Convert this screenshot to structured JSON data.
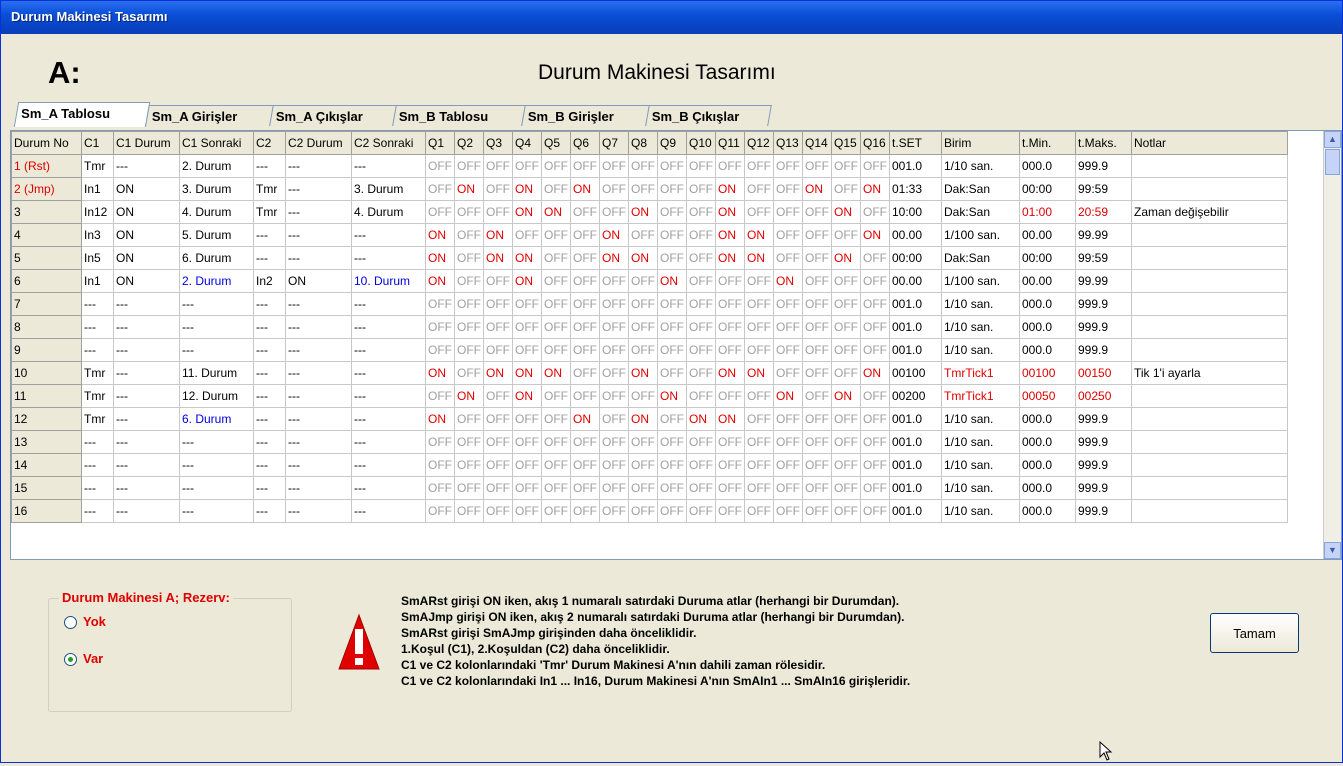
{
  "window": {
    "title": "Durum Makinesi Tasarımı"
  },
  "header": {
    "letter": "A:",
    "title": "Durum Makinesi Tasarımı"
  },
  "tabs": [
    "Sm_A Tablosu",
    "Sm_A Girişler",
    "Sm_A Çıkışlar",
    "Sm_B Tablosu",
    "Sm_B Girişler",
    "Sm_B Çıkışlar"
  ],
  "table": {
    "columns": [
      "Durum No",
      "C1",
      "C1 Durum",
      "C1 Sonraki",
      "C2",
      "C2 Durum",
      "C2 Sonraki",
      "Q1",
      "Q2",
      "Q3",
      "Q4",
      "Q5",
      "Q6",
      "Q7",
      "Q8",
      "Q9",
      "Q10",
      "Q11",
      "Q12",
      "Q13",
      "Q14",
      "Q15",
      "Q16",
      "t.SET",
      "Birim",
      "t.Min.",
      "t.Maks.",
      "Notlar"
    ],
    "rows": [
      {
        "no": "1 (Rst)",
        "c1": "Tmr",
        "c1d": "---",
        "c1s": "2. Durum",
        "c2": "---",
        "c2d": "---",
        "c2s": "---",
        "q": "0000000000000000",
        "tset": "001.0",
        "birim": "1/10 san.",
        "tmin": "000.0",
        "tmax": "999.9",
        "not": ""
      },
      {
        "no": "2 (Jmp)",
        "c1": "In1",
        "c1d": "ON",
        "c1s": "3. Durum",
        "c2": "Tmr",
        "c2d": "---",
        "c2s": "3. Durum",
        "q": "0101010000100101",
        "tset": "01:33",
        "birim": "Dak:San",
        "tmin": "00:00",
        "tmax": "99:59",
        "not": ""
      },
      {
        "no": "3",
        "c1": "In12",
        "c1d": "ON",
        "c1s": "4. Durum",
        "c2": "Tmr",
        "c2d": "---",
        "c2s": "4. Durum",
        "q": "0001100100100010",
        "tset": "10:00",
        "birim": "Dak:San",
        "tmin": "01:00",
        "tmax": "20:59",
        "not": "Zaman değişebilir"
      },
      {
        "no": "4",
        "c1": "In3",
        "c1d": "ON",
        "c1s": "5. Durum",
        "c2": "---",
        "c2d": "---",
        "c2s": "---",
        "q": "1010001000110001",
        "tset": "00.00",
        "birim": "1/100 san.",
        "tmin": "00.00",
        "tmax": "99.99",
        "not": ""
      },
      {
        "no": "5",
        "c1": "In5",
        "c1d": "ON",
        "c1s": "6. Durum",
        "c2": "---",
        "c2d": "---",
        "c2s": "---",
        "q": "1011001100110010",
        "tset": "00:00",
        "birim": "Dak:San",
        "tmin": "00:00",
        "tmax": "99:59",
        "not": ""
      },
      {
        "no": "6",
        "c1": "In1",
        "c1d": "ON",
        "c1s": "2. Durum",
        "c2": "In2",
        "c2d": "ON",
        "c2s": "10. Durum",
        "q": "1001000010001000",
        "tset": "00.00",
        "birim": "1/100 san.",
        "tmin": "00.00",
        "tmax": "99.99",
        "not": ""
      },
      {
        "no": "7",
        "c1": "---",
        "c1d": "---",
        "c1s": "---",
        "c2": "---",
        "c2d": "---",
        "c2s": "---",
        "q": "0000000000000000",
        "tset": "001.0",
        "birim": "1/10 san.",
        "tmin": "000.0",
        "tmax": "999.9",
        "not": ""
      },
      {
        "no": "8",
        "c1": "---",
        "c1d": "---",
        "c1s": "---",
        "c2": "---",
        "c2d": "---",
        "c2s": "---",
        "q": "0000000000000000",
        "tset": "001.0",
        "birim": "1/10 san.",
        "tmin": "000.0",
        "tmax": "999.9",
        "not": ""
      },
      {
        "no": "9",
        "c1": "---",
        "c1d": "---",
        "c1s": "---",
        "c2": "---",
        "c2d": "---",
        "c2s": "---",
        "q": "0000000000000000",
        "tset": "001.0",
        "birim": "1/10 san.",
        "tmin": "000.0",
        "tmax": "999.9",
        "not": ""
      },
      {
        "no": "10",
        "c1": "Tmr",
        "c1d": "---",
        "c1s": "11. Durum",
        "c2": "---",
        "c2d": "---",
        "c2s": "---",
        "q": "1011100100110001",
        "tset": "00100",
        "birim": "TmrTick1",
        "tmin": "00100",
        "tmax": "00150",
        "not": "Tik 1'i ayarla"
      },
      {
        "no": "11",
        "c1": "Tmr",
        "c1d": "---",
        "c1s": "12. Durum",
        "c2": "---",
        "c2d": "---",
        "c2s": "---",
        "q": "0101000010001010",
        "tset": "00200",
        "birim": "TmrTick1",
        "tmin": "00050",
        "tmax": "00250",
        "not": ""
      },
      {
        "no": "12",
        "c1": "Tmr",
        "c1d": "---",
        "c1s": "6. Durum",
        "c2": "---",
        "c2d": "---",
        "c2s": "---",
        "q": "1000010101100000",
        "tset": "001.0",
        "birim": "1/10 san.",
        "tmin": "000.0",
        "tmax": "999.9",
        "not": ""
      },
      {
        "no": "13",
        "c1": "---",
        "c1d": "---",
        "c1s": "---",
        "c2": "---",
        "c2d": "---",
        "c2s": "---",
        "q": "0000000000000000",
        "tset": "001.0",
        "birim": "1/10 san.",
        "tmin": "000.0",
        "tmax": "999.9",
        "not": ""
      },
      {
        "no": "14",
        "c1": "---",
        "c1d": "---",
        "c1s": "---",
        "c2": "---",
        "c2d": "---",
        "c2s": "---",
        "q": "0000000000000000",
        "tset": "001.0",
        "birim": "1/10 san.",
        "tmin": "000.0",
        "tmax": "999.9",
        "not": ""
      },
      {
        "no": "15",
        "c1": "---",
        "c1d": "---",
        "c1s": "---",
        "c2": "---",
        "c2d": "---",
        "c2s": "---",
        "q": "0000000000000000",
        "tset": "001.0",
        "birim": "1/10 san.",
        "tmin": "000.0",
        "tmax": "999.9",
        "not": ""
      },
      {
        "no": "16",
        "c1": "---",
        "c1d": "---",
        "c1s": "---",
        "c2": "---",
        "c2d": "---",
        "c2s": "---",
        "q": "0000000000000000",
        "tset": "001.0",
        "birim": "1/10 san.",
        "tmin": "000.0",
        "tmax": "999.9",
        "not": ""
      }
    ],
    "on_label": "ON",
    "off_label": "OFF",
    "red_rows_timing": [
      "3",
      "10",
      "11"
    ],
    "blue_cells": {
      "6": [
        "c1s",
        "c2s"
      ],
      "12": [
        "c1s"
      ]
    }
  },
  "reserve": {
    "title": "Durum Makinesi A; Rezerv:",
    "options": [
      {
        "label": "Yok",
        "checked": false
      },
      {
        "label": "Var",
        "checked": true
      }
    ]
  },
  "info": {
    "icon": "warning-icon",
    "lines": [
      "SmARst girişi ON iken, akış 1 numaralı satırdaki Duruma atlar (herhangi bir Durumdan).",
      "SmAJmp girişi ON iken, akış 2 numaralı satırdaki Duruma atlar (herhangi bir Durumdan).",
      "SmARst girişi SmAJmp girişinden daha önceliklidir.",
      "1.Koşul (C1), 2.Koşuldan (C2) daha önceliklidir.",
      "C1 ve C2 kolonlarındaki 'Tmr' Durum Makinesi A'nın dahili zaman rölesidir.",
      "C1 ve C2 kolonlarındaki In1 ... In16, Durum Makinesi A'nın SmAIn1 ... SmAIn16 girişleridir."
    ]
  },
  "ok_button": "Tamam",
  "colors": {
    "on": "#e00000",
    "off": "#a0a0a0",
    "titlebar": "#0a4fd8",
    "link": "#0000e0"
  }
}
